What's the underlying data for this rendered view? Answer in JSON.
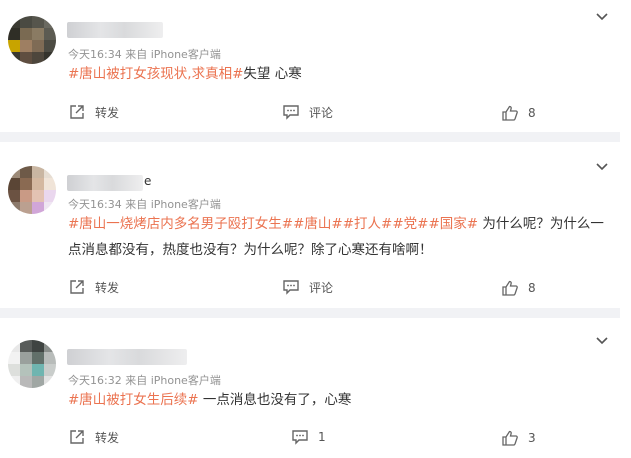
{
  "posts": [
    {
      "meta": "今天16:34  来自 iPhone客户端",
      "segments": [
        {
          "type": "tag",
          "text": "#唐山被打女孩现状,求真相#"
        },
        {
          "type": "text",
          "text": "失望 心寒"
        }
      ],
      "actions": {
        "repost": "转发",
        "comment": "评论",
        "likes": "8"
      }
    },
    {
      "meta": "今天16:34  来自 iPhone客户端",
      "name_suffix": "e",
      "segments": [
        {
          "type": "tag",
          "text": "#唐山一烧烤店内多名男子殴打女生#"
        },
        {
          "type": "tag",
          "text": "#唐山#"
        },
        {
          "type": "tag",
          "text": "#打人#"
        },
        {
          "type": "tag",
          "text": "#党#"
        },
        {
          "type": "tag",
          "text": "#国家#"
        },
        {
          "type": "text",
          "text": " 为什么呢？为什么一点消息都没有，热度也没有？为什么呢？除了心寒还有啥啊！"
        }
      ],
      "actions": {
        "repost": "转发",
        "comment": "评论",
        "likes": "8"
      }
    },
    {
      "meta": "今天16:32  来自 iPhone客户端",
      "segments": [
        {
          "type": "tag",
          "text": "#唐山被打女生后续#"
        },
        {
          "type": "text",
          "text": " 一点消息也没有了，心寒"
        }
      ],
      "actions": {
        "repost": "转发",
        "comment": "1",
        "likes": "3"
      }
    }
  ],
  "icons": {
    "repost": "repost-icon",
    "comment": "comment-icon",
    "like": "thumbs-up-icon",
    "more": "chevron-down-icon"
  },
  "colors": {
    "tag": "#eb7350",
    "meta": "#939393",
    "divider": "#f1f2f5"
  }
}
